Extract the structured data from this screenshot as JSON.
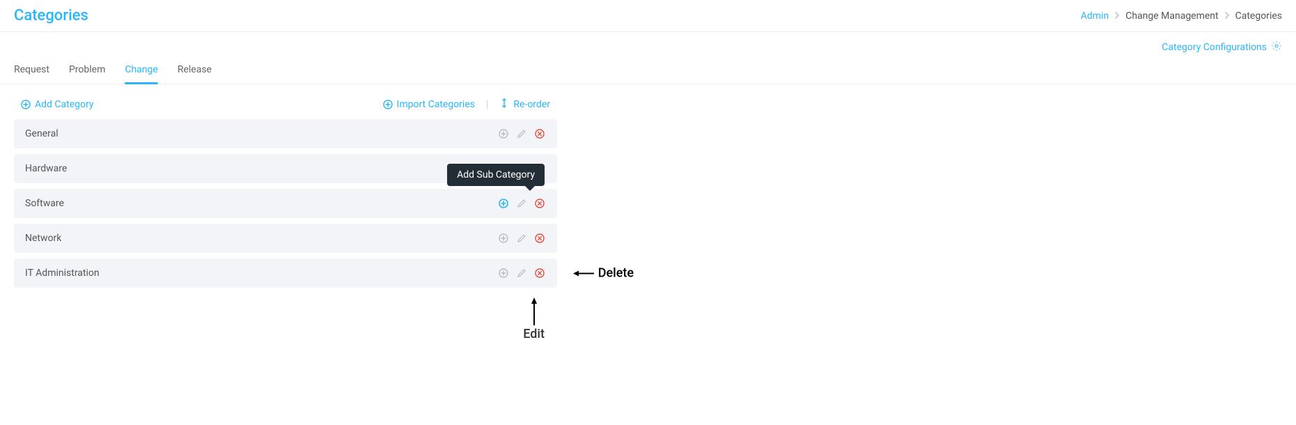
{
  "header": {
    "title": "Categories",
    "breadcrumb": {
      "admin": "Admin",
      "mid": "Change Management",
      "last": "Categories"
    }
  },
  "config_link": "Category Configurations",
  "tabs": [
    {
      "label": "Request",
      "active": false
    },
    {
      "label": "Problem",
      "active": false
    },
    {
      "label": "Change",
      "active": true
    },
    {
      "label": "Release",
      "active": false
    }
  ],
  "toolbar": {
    "add": "Add Category",
    "import": "Import Categories",
    "reorder": "Re-order"
  },
  "categories": [
    {
      "name": "General"
    },
    {
      "name": "Hardware"
    },
    {
      "name": "Software"
    },
    {
      "name": "Network"
    },
    {
      "name": "IT Administration"
    }
  ],
  "tooltip": {
    "add_sub": "Add Sub Category"
  },
  "annotations": {
    "delete": "Delete",
    "edit": "Edit"
  }
}
